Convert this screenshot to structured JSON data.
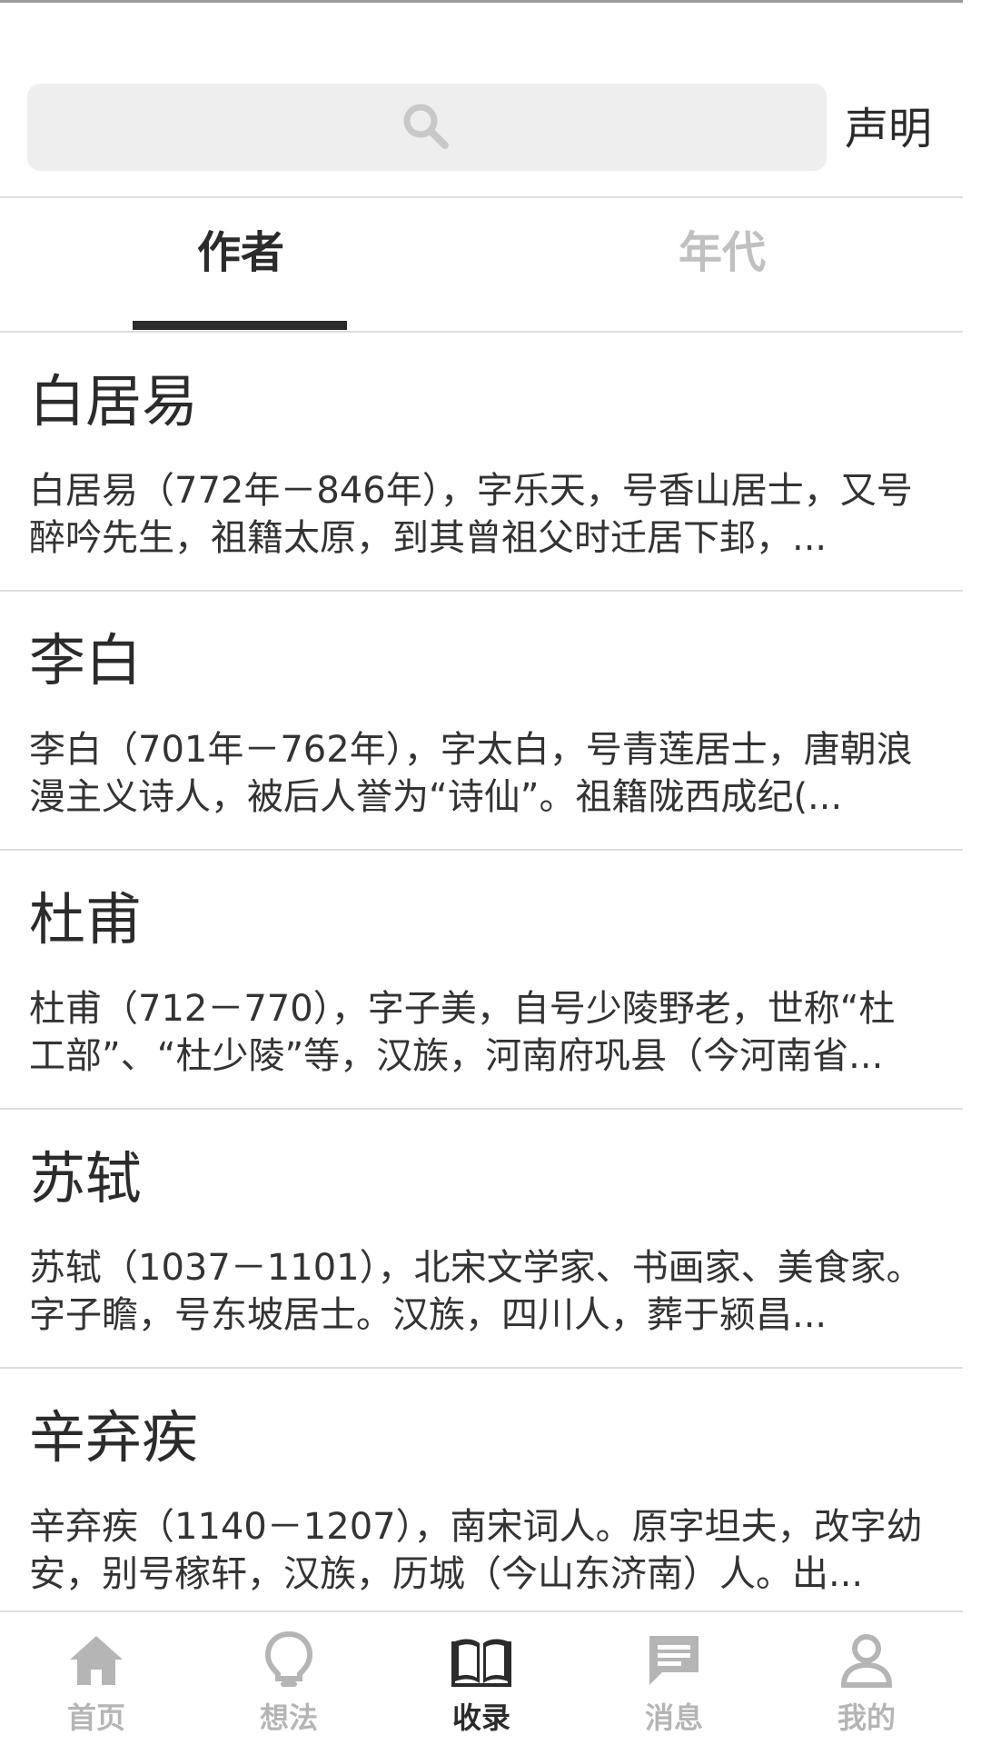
{
  "header": {
    "search_icon": "search-icon",
    "declare_label": "声明"
  },
  "tabs": [
    {
      "label": "作者",
      "active": true
    },
    {
      "label": "年代",
      "active": false
    }
  ],
  "authors": [
    {
      "name": "白居易",
      "desc": "白居易（772年－846年），字乐天，号香山居士，又号醉吟先生，祖籍太原，到其曾祖父时迁居下邽，..."
    },
    {
      "name": "李白",
      "desc": "李白（701年－762年），字太白，号青莲居士，唐朝浪漫主义诗人，被后人誉为“诗仙”。祖籍陇西成纪(..."
    },
    {
      "name": "杜甫",
      "desc": "杜甫（712－770），字子美，自号少陵野老，世称“杜工部”、“杜少陵”等，汉族，河南府巩县（今河南省..."
    },
    {
      "name": "苏轼",
      "desc": "苏轼（1037－1101），北宋文学家、书画家、美食家。字子瞻，号东坡居士。汉族，四川人，葬于颍昌..."
    },
    {
      "name": "辛弃疾",
      "desc": "辛弃疾（1140－1207），南宋词人。原字坦夫，改字幼安，别号稼轩，汉族，历城（今山东济南）人。出..."
    }
  ],
  "bottom_nav": [
    {
      "label": "首页",
      "icon": "home-icon",
      "active": false
    },
    {
      "label": "想法",
      "icon": "lightbulb-icon",
      "active": false
    },
    {
      "label": "收录",
      "icon": "book-icon",
      "active": true
    },
    {
      "label": "消息",
      "icon": "message-icon",
      "active": false
    },
    {
      "label": "我的",
      "icon": "user-icon",
      "active": false
    }
  ],
  "colors": {
    "text_primary": "#2b2b2b",
    "text_inactive": "#c0c0c0",
    "nav_inactive": "#b5b5b5",
    "divider": "#dddddd",
    "search_bg": "#eeeeee"
  }
}
